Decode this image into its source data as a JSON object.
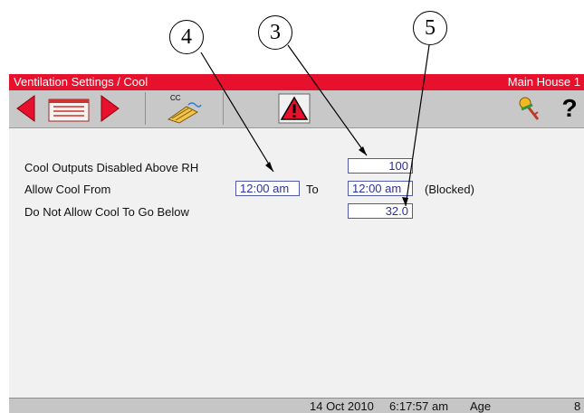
{
  "callouts": [
    "4",
    "3",
    "5"
  ],
  "titlebar": {
    "title": "Ventilation Settings / Cool",
    "house": "Main House 1"
  },
  "toolbar": {
    "cc_label": "CC",
    "help_label": "?"
  },
  "settings": {
    "rh_label": "Cool Outputs Disabled Above RH",
    "rh_value": "100",
    "allow_label": "Allow Cool From",
    "allow_from": "12:00 am",
    "to_label": "To",
    "allow_to": "12:00 am",
    "blocked_label": "(Blocked)",
    "below_label": "Do Not Allow Cool To Go Below",
    "below_value": "32.0"
  },
  "status": {
    "date": "14 Oct 2010",
    "time": "6:17:57 am",
    "age_label": "Age",
    "age_value": "8"
  },
  "colors": {
    "title_red": "#e8112d",
    "arrow_red": "#e8112d",
    "field_text": "#2a2fa0"
  }
}
